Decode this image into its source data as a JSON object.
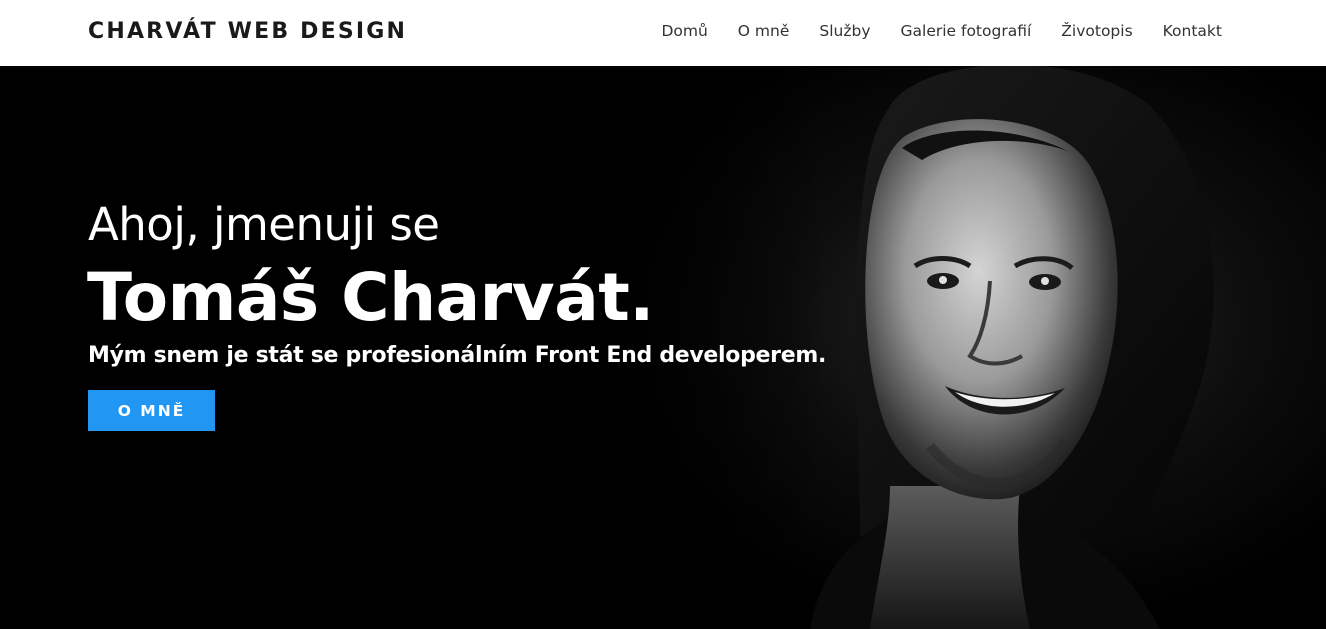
{
  "nav": {
    "brand": "CHARVÁT WEB DESIGN",
    "links": [
      {
        "label": "Domů"
      },
      {
        "label": "O mně"
      },
      {
        "label": "Služby"
      },
      {
        "label": "Galerie fotografií"
      },
      {
        "label": "Životopis"
      },
      {
        "label": "Kontakt"
      }
    ]
  },
  "hero": {
    "greeting": "Ahoj, jmenuji se",
    "name": "Tomáš Charvát.",
    "tagline": "Mým snem je stát se profesionálním Front End developerem.",
    "cta_label": "O MNĚ"
  },
  "colors": {
    "accent": "#2196f3",
    "hero_background": "#000000",
    "navbar_background": "#ffffff"
  }
}
